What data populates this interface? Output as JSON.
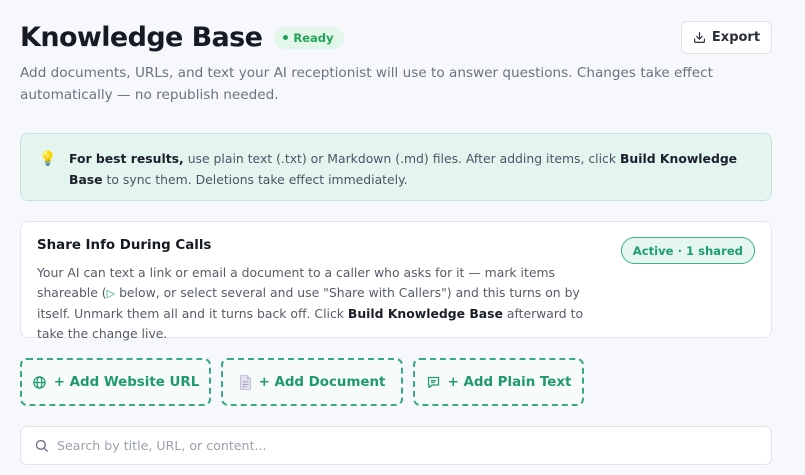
{
  "header": {
    "title": "Knowledge Base",
    "status": "Ready",
    "export_label": "Export",
    "subtitle": "Add documents, URLs, and text your AI receptionist will use to answer questions. Changes take effect automatically — no republish needed."
  },
  "tip": {
    "icon": "lightbulb-icon",
    "lead": "For best results,",
    "text1": " use plain text (.txt) or Markdown (.md) files. After adding items, click ",
    "bold": "Build Knowledge Base",
    "text2": " to sync them. Deletions take effect immediately."
  },
  "share": {
    "title": "Share Info During Calls",
    "status": "Active · 1 shared",
    "text1": "Your AI can text a link or email a document to a caller who asks for it — mark items shareable (",
    "icon_glyph": "▷",
    "text2": " below, or select several and use \"Share with Callers\") and this turns on by itself. Unmark them all and it turns back off. Click ",
    "bold": "Build Knowledge Base",
    "text3": " afterward to take the change live."
  },
  "actions": {
    "add_url": "+ Add Website URL",
    "add_document": "+ Add Document",
    "add_text": "+ Add Plain Text"
  },
  "search": {
    "placeholder": "Search by title, URL, or content...",
    "value": ""
  },
  "colors": {
    "accent": "#1f9a6f",
    "ready_green": "#23a25a",
    "tip_bg": "#e4f5f0"
  }
}
